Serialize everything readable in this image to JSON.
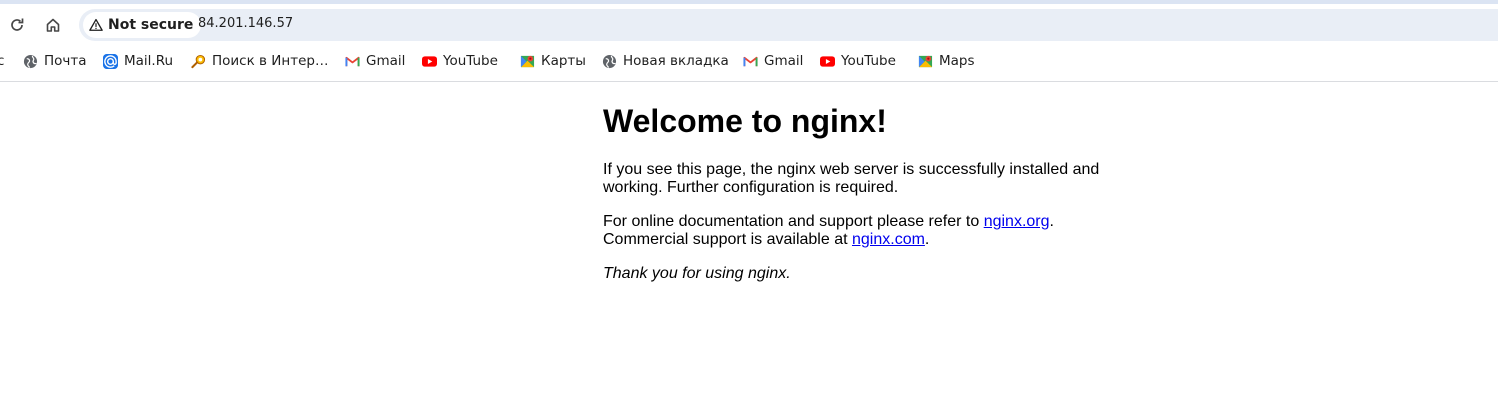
{
  "toolbar": {
    "security_label": "Not secure",
    "url": "84.201.146.57"
  },
  "bookmarks": [
    {
      "label": "с",
      "icon": "truncated"
    },
    {
      "label": "Почта",
      "icon": "globe-icon"
    },
    {
      "label": "Mail.Ru",
      "icon": "mailru-icon"
    },
    {
      "label": "Поиск в Интер…",
      "icon": "search-key-icon"
    },
    {
      "label": "Gmail",
      "icon": "gmail-icon"
    },
    {
      "label": "YouTube",
      "icon": "youtube-icon"
    },
    {
      "label": "Карты",
      "icon": "maps-icon"
    },
    {
      "label": "Новая вкладка",
      "icon": "globe-icon"
    },
    {
      "label": "Gmail",
      "icon": "gmail-icon"
    },
    {
      "label": "YouTube",
      "icon": "youtube-icon"
    },
    {
      "label": "Maps",
      "icon": "maps-icon"
    }
  ],
  "page": {
    "title": "Welcome to nginx!",
    "p1": "If you see this page, the nginx web server is successfully installed and working. Further configuration is required.",
    "p2_before": "For online documentation and support please refer to ",
    "link1": "nginx.org",
    "p2_mid": ".",
    "p2_line2": "Commercial support is available at ",
    "link2": "nginx.com",
    "p2_end": ".",
    "thanks": "Thank you for using nginx."
  },
  "colors": {
    "link": "#0000ee",
    "omnibox": "#e9eef6",
    "youtube": "#ff0000",
    "gmail": "#ea4335"
  }
}
